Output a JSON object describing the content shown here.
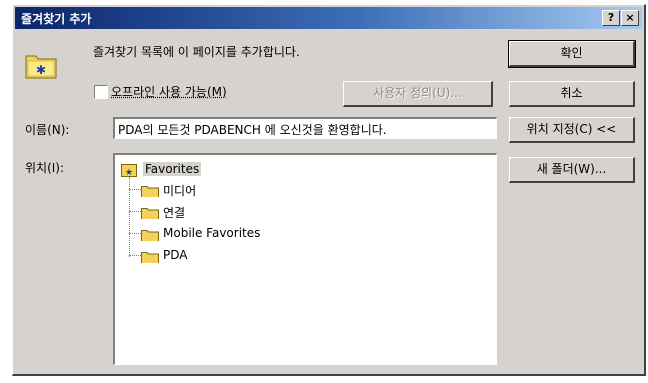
{
  "window": {
    "title": "즐겨찾기 추가",
    "help_button": "?",
    "close_button": "×"
  },
  "intro_text": "즐겨찾기 목록에 이 페이지를 추가합니다.",
  "offline_checkbox": {
    "label": "오프라인 사용 가능(M)",
    "checked": false
  },
  "customize_button": "사용자 정의(U)...",
  "name_label": "이름(N):",
  "name_value": "PDA의 모든것 PDABENCH 에 오신것을 환영합니다.",
  "location_label": "위치(I):",
  "tree": {
    "root": "Favorites",
    "children": [
      "미디어",
      "연결",
      "Mobile Favorites",
      "PDA"
    ]
  },
  "buttons": {
    "ok": "확인",
    "cancel": "취소",
    "location": "위치 지정(C) <<",
    "new_folder": "새 폴더(W)..."
  }
}
